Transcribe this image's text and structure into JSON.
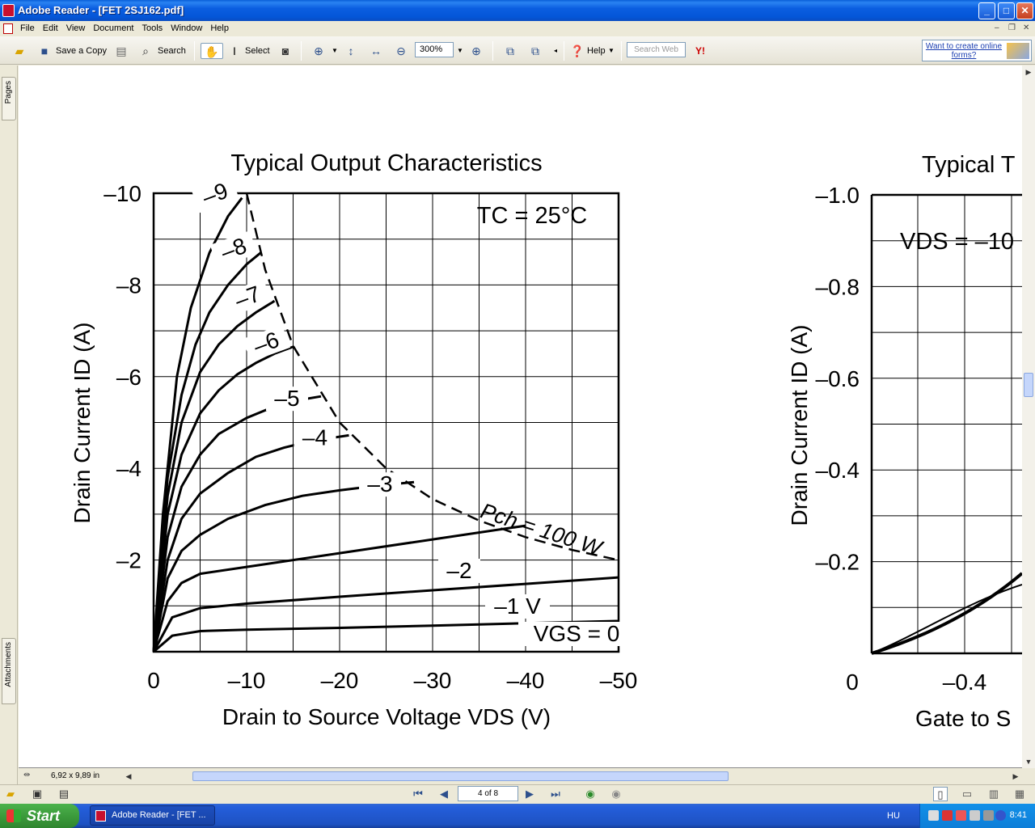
{
  "window": {
    "title": "Adobe Reader - [FET 2SJ162.pdf]",
    "controls": {
      "minimize": "_",
      "maximize": "□",
      "close": "✕"
    }
  },
  "menu": [
    "File",
    "Edit",
    "View",
    "Document",
    "Tools",
    "Window",
    "Help"
  ],
  "toolbar": {
    "save_copy_label": "Save a Copy",
    "search_label": "Search",
    "select_label": "Select",
    "zoom_value": "300%",
    "help_label": "Help",
    "search_web_placeholder": "Search Web",
    "forms_link": "Want to create online forms?"
  },
  "nav_tabs": {
    "pages": "Pages",
    "attachments": "Attachments"
  },
  "status": {
    "page_size": "6,92 x 9,89 in",
    "page_indicator": "4 of 8"
  },
  "taskbar": {
    "start_label": "Start",
    "task_label": "Adobe Reader - [FET ...",
    "language": "HU",
    "clock": "8:41"
  },
  "colors": {
    "titlebar": "#0a5fd8",
    "start": "#3c9b3c",
    "accent_link": "#1a3db0"
  },
  "chart_data": [
    {
      "type": "line",
      "title": "Typical Output Characteristics",
      "annotation": "TC = 25°C",
      "xlabel": "Drain to Source Voltage  VDS  (V)",
      "ylabel": "Drain Current  ID  (A)",
      "xlim": [
        0,
        -50
      ],
      "ylim": [
        0,
        -10
      ],
      "x_ticks": [
        "0",
        "–10",
        "–20",
        "–30",
        "–40",
        "–50"
      ],
      "y_ticks": [
        "–2",
        "–4",
        "–6",
        "–8",
        "–10"
      ],
      "grid": true,
      "power_limit_label": "Pch = 100 W",
      "power_limit": {
        "x": [
          -10,
          -12,
          -15,
          -20,
          -25,
          -30,
          -35,
          -40,
          -45,
          -50
        ],
        "y": [
          -10,
          -8.33,
          -6.67,
          -5.0,
          -4.0,
          -3.33,
          -2.86,
          -2.5,
          -2.22,
          -2.0
        ]
      },
      "series": [
        {
          "name": "VGS = 0",
          "x": [
            0,
            -2,
            -5,
            -10,
            -20,
            -30,
            -40,
            -50
          ],
          "y": [
            0,
            -0.35,
            -0.45,
            -0.48,
            -0.52,
            -0.57,
            -0.62,
            -0.67
          ]
        },
        {
          "name": "–1 V",
          "x": [
            0,
            -2,
            -5,
            -10,
            -20,
            -30,
            -40,
            -50
          ],
          "y": [
            0,
            -0.75,
            -0.95,
            -1.05,
            -1.2,
            -1.34,
            -1.48,
            -1.62
          ]
        },
        {
          "name": "–2",
          "x": [
            0,
            -1.5,
            -3,
            -5,
            -10,
            -20,
            -30,
            -40
          ],
          "y": [
            0,
            -1.1,
            -1.5,
            -1.7,
            -1.85,
            -2.15,
            -2.45,
            -2.75
          ]
        },
        {
          "name": "–3",
          "x": [
            0,
            -1.5,
            -3,
            -5,
            -8,
            -12,
            -16,
            -20,
            -24,
            -28
          ],
          "y": [
            0,
            -1.6,
            -2.2,
            -2.55,
            -2.9,
            -3.2,
            -3.4,
            -3.52,
            -3.62,
            -3.7
          ]
        },
        {
          "name": "–4",
          "x": [
            0,
            -1.5,
            -3,
            -5,
            -8,
            -11,
            -14,
            -17,
            -21
          ],
          "y": [
            0,
            -2.0,
            -2.9,
            -3.45,
            -3.9,
            -4.25,
            -4.45,
            -4.6,
            -4.72
          ]
        },
        {
          "name": "–5",
          "x": [
            0,
            -1.5,
            -3,
            -5,
            -7,
            -10,
            -13,
            -16,
            -18
          ],
          "y": [
            0,
            -2.5,
            -3.6,
            -4.3,
            -4.75,
            -5.1,
            -5.35,
            -5.5,
            -5.57
          ]
        },
        {
          "name": "–6",
          "x": [
            0,
            -1.5,
            -3,
            -5,
            -7,
            -9,
            -11,
            -13,
            -15
          ],
          "y": [
            0,
            -3.0,
            -4.3,
            -5.2,
            -5.7,
            -6.05,
            -6.3,
            -6.5,
            -6.65
          ]
        },
        {
          "name": "–7",
          "x": [
            0,
            -1.5,
            -3,
            -5,
            -7,
            -9,
            -11,
            -13
          ],
          "y": [
            0,
            -3.4,
            -5.0,
            -6.1,
            -6.7,
            -7.1,
            -7.4,
            -7.65
          ]
        },
        {
          "name": "–8",
          "x": [
            0,
            -1.5,
            -3,
            -4.5,
            -6,
            -8,
            -10,
            -11.5
          ],
          "y": [
            0,
            -3.8,
            -5.6,
            -6.7,
            -7.4,
            -8.0,
            -8.45,
            -8.7
          ]
        },
        {
          "name": "–9",
          "x": [
            0,
            -1,
            -2.5,
            -4,
            -6,
            -8,
            -9.5
          ],
          "y": [
            0,
            -3.0,
            -6.0,
            -7.5,
            -8.7,
            -9.5,
            -9.9
          ]
        }
      ]
    },
    {
      "type": "line",
      "title": "Typical T",
      "annotation": "VDS = –10",
      "xlabel": "Gate to S",
      "ylabel": "Drain Current  ID  (A)",
      "y_ticks": [
        "–0.2",
        "–0.4",
        "–0.6",
        "–0.8",
        "–1.0"
      ],
      "x_ticks": [
        "0",
        "–0.4"
      ],
      "ylim": [
        0,
        -1.0
      ],
      "grid": true
    }
  ]
}
